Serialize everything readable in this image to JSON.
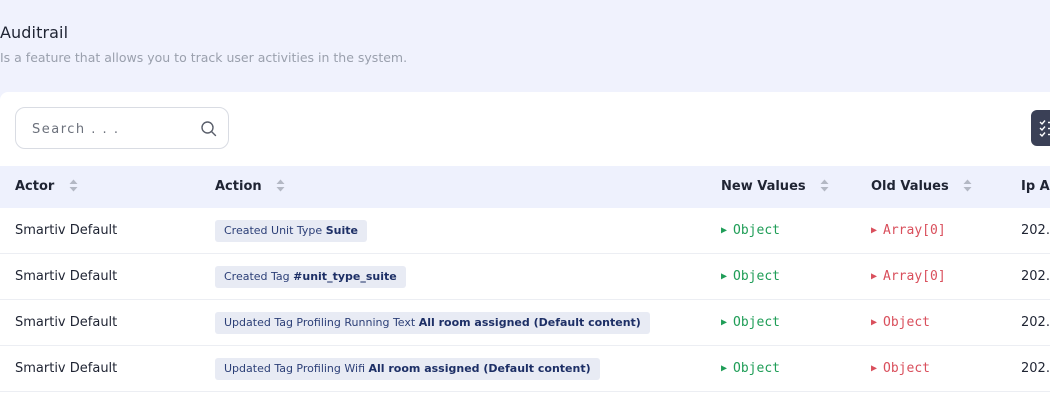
{
  "header": {
    "title": "Auditrail",
    "subtitle": "Is a feature that allows you to track user activities in the system."
  },
  "search": {
    "placeholder": "Search . . ."
  },
  "table": {
    "columns": [
      "Actor",
      "Action",
      "New Values",
      "Old Values",
      "Ip Ad"
    ],
    "rows": [
      {
        "actor": "Smartiv Default",
        "action_prefix": "Created Unit Type ",
        "action_bold": "Suite",
        "new_values": "Object",
        "old_values": "Array[0]",
        "ip": "202."
      },
      {
        "actor": "Smartiv Default",
        "action_prefix": "Created Tag ",
        "action_bold": "#unit_type_suite",
        "new_values": "Object",
        "old_values": "Array[0]",
        "ip": "202."
      },
      {
        "actor": "Smartiv Default",
        "action_prefix": "Updated Tag Profiling Running Text ",
        "action_bold": "All room assigned (Default content)",
        "new_values": "Object",
        "old_values": "Object",
        "ip": "202."
      },
      {
        "actor": "Smartiv Default",
        "action_prefix": "Updated Tag Profiling Wifi ",
        "action_bold": "All room assigned (Default content)",
        "new_values": "Object",
        "old_values": "Object",
        "ip": "202."
      }
    ]
  },
  "icons": {
    "search": "search-icon",
    "filter": "checklist-icon",
    "sort": "sort-icon",
    "expand": "triangle-right-icon"
  },
  "colors": {
    "new_values": "#1f9d57",
    "old_values": "#d94f5c",
    "header_bg": "#eef1fd",
    "tag_bg": "#e8ebf4"
  }
}
